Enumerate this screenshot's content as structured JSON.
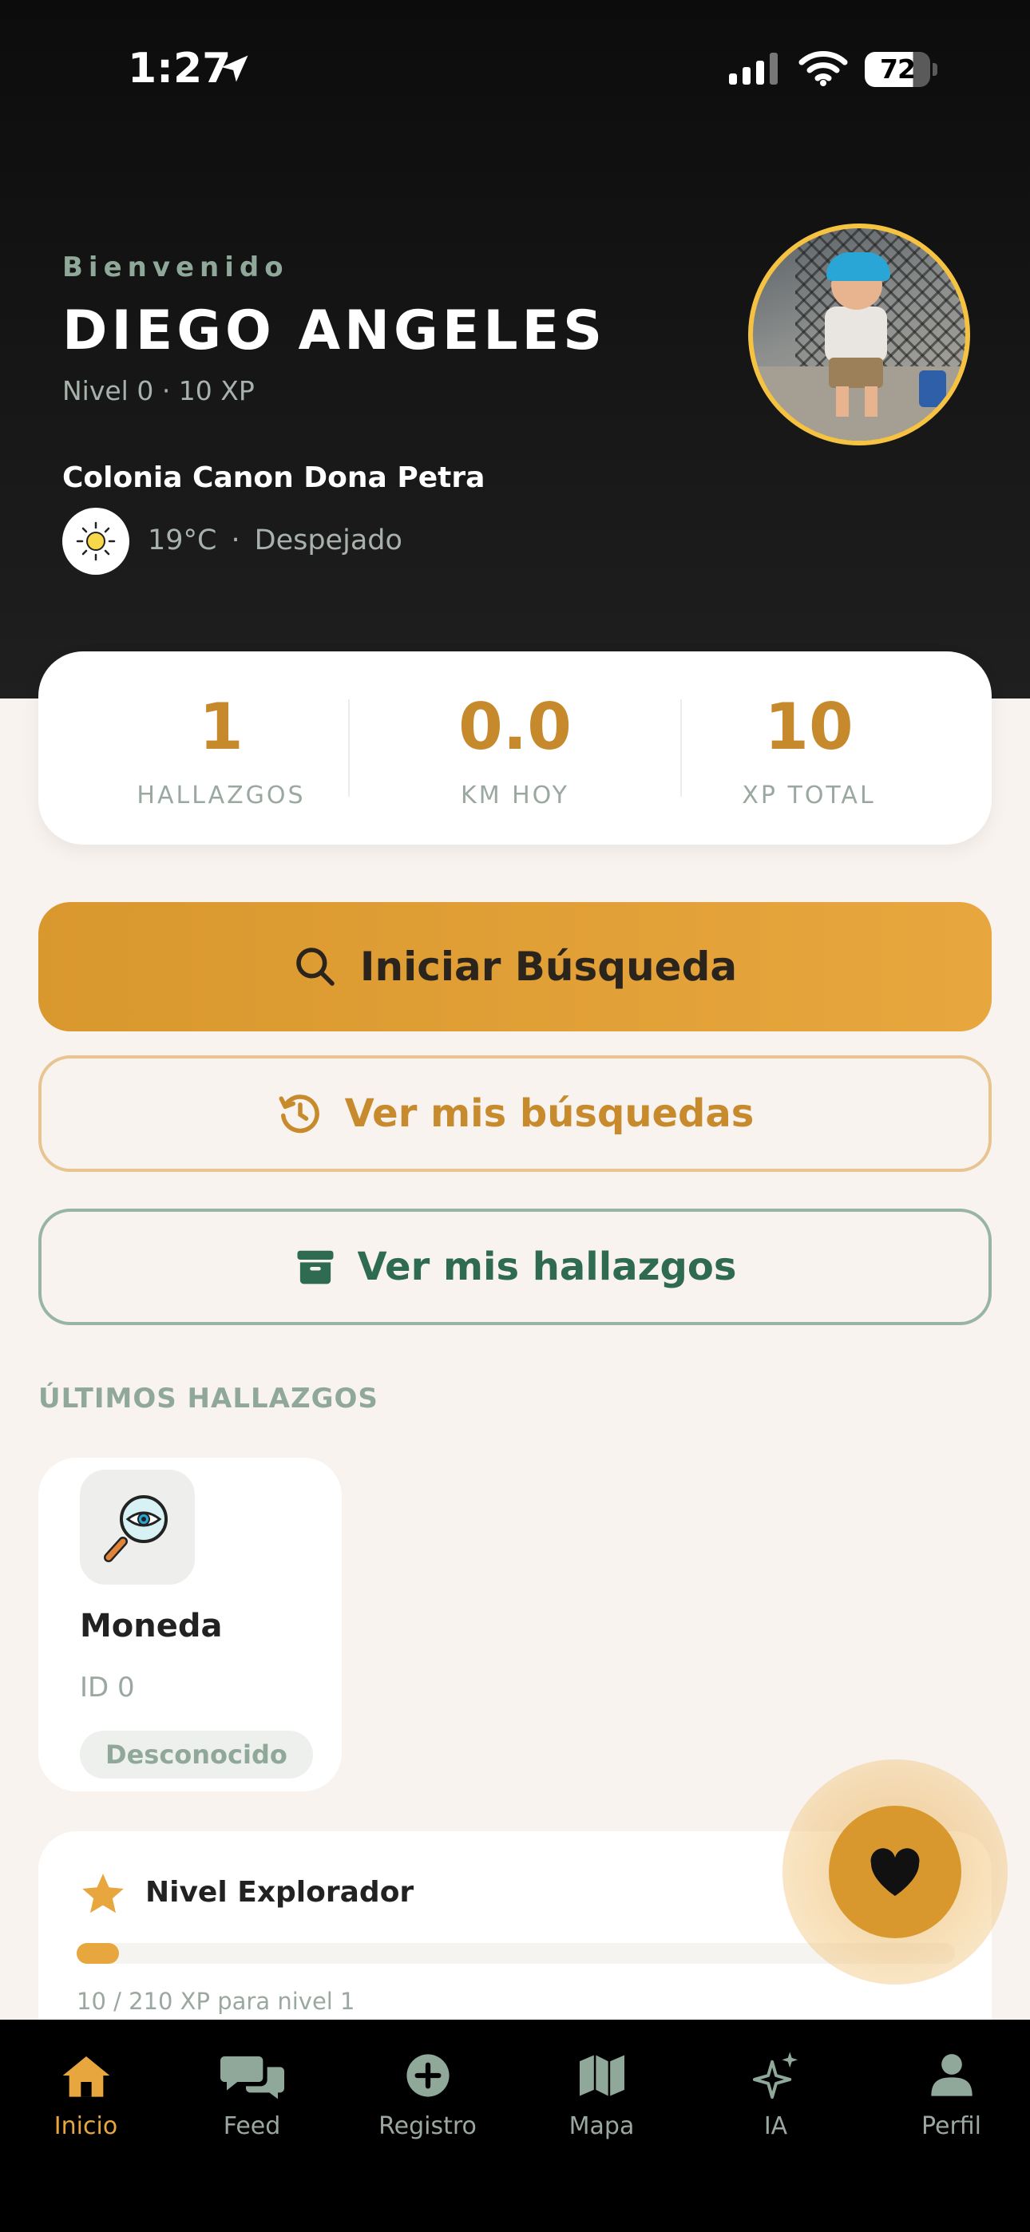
{
  "status_bar": {
    "time": "1:27",
    "battery": "72"
  },
  "header": {
    "welcome": "Bienvenido",
    "user_name": "DIEGO ANGELES",
    "level_line": "Nivel 0 · 10 XP",
    "colonia": "Colonia Canon Dona Petra",
    "weather": {
      "temp": "19°C",
      "separator": "·",
      "condition": "Despejado",
      "icon": "sun-icon"
    }
  },
  "stats": [
    {
      "value": "1",
      "label": "HALLAZGOS"
    },
    {
      "value": "0.0",
      "label": "KM HOY"
    },
    {
      "value": "10",
      "label": "XP TOTAL"
    }
  ],
  "actions": {
    "start_search": "Iniciar Búsqueda",
    "my_searches": "Ver mis búsquedas",
    "my_finds": "Ver mis hallazgos"
  },
  "recent_finds": {
    "title": "ÚLTIMOS HALLAZGOS",
    "items": [
      {
        "name": "Moneda",
        "id": "ID 0",
        "badge": "Desconocido",
        "icon": "magnifier-eye-icon"
      }
    ]
  },
  "level_card": {
    "title": "Nivel Explorador",
    "progress_text": "10 / 210 XP para nivel 1",
    "progress_fraction": 0.048
  },
  "tabbar": [
    {
      "label": "Inicio",
      "icon": "home-icon",
      "active": true
    },
    {
      "label": "Feed",
      "icon": "chat-bubbles-icon",
      "active": false
    },
    {
      "label": "Registro",
      "icon": "plus-circle-icon",
      "active": false
    },
    {
      "label": "Mapa",
      "icon": "map-icon",
      "active": false
    },
    {
      "label": "IA",
      "icon": "sparkles-icon",
      "active": false
    },
    {
      "label": "Perfil",
      "icon": "person-icon",
      "active": false
    }
  ],
  "colors": {
    "accent": "#e8a73e",
    "accent_text": "#c78a2c",
    "green": "#2f6a52",
    "muted": "#8fa89a"
  }
}
